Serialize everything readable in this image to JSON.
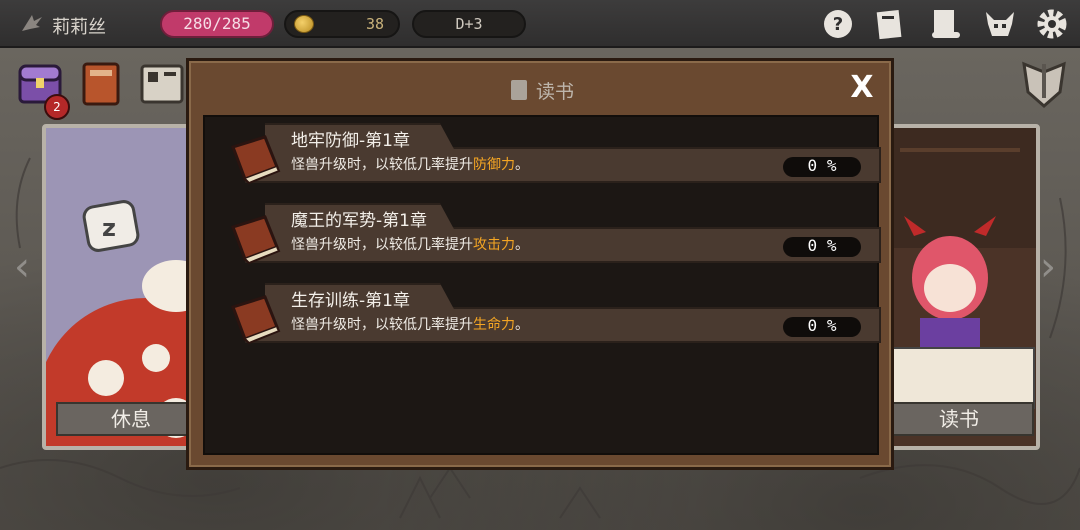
{
  "topbar": {
    "player_name": "莉莉丝",
    "hp": "280/285",
    "gold": "38",
    "day": "D+3",
    "icons": [
      "help-icon",
      "card-icon",
      "scroll-icon",
      "demon-helmet-icon",
      "gear-icon"
    ]
  },
  "left_menu": {
    "icons": [
      "treasure-chest-icon",
      "spellbook-icon",
      "blueprint-icon"
    ],
    "chest_badge": "2"
  },
  "scenes": {
    "left_label": "休息",
    "right_label": "读书"
  },
  "modal": {
    "title": "读书",
    "close_label": "X",
    "books": [
      {
        "name": "地牢防御-第1章",
        "desc_prefix": "怪兽升级时，以较低几率提升",
        "desc_highlight": "防御力",
        "desc_suffix": "。",
        "progress": "0 %"
      },
      {
        "name": "魔王的军势-第1章",
        "desc_prefix": "怪兽升级时，以较低几率提升",
        "desc_highlight": "攻击力",
        "desc_suffix": "。",
        "progress": "0 %"
      },
      {
        "name": "生存训练-第1章",
        "desc_prefix": "怪兽升级时，以较低几率提升",
        "desc_highlight": "生命力",
        "desc_suffix": "。",
        "progress": "0 %"
      }
    ]
  },
  "colors": {
    "hp_pill": "#c13a6a",
    "highlight": "#f5a623",
    "modal_frame": "#6a4930"
  }
}
